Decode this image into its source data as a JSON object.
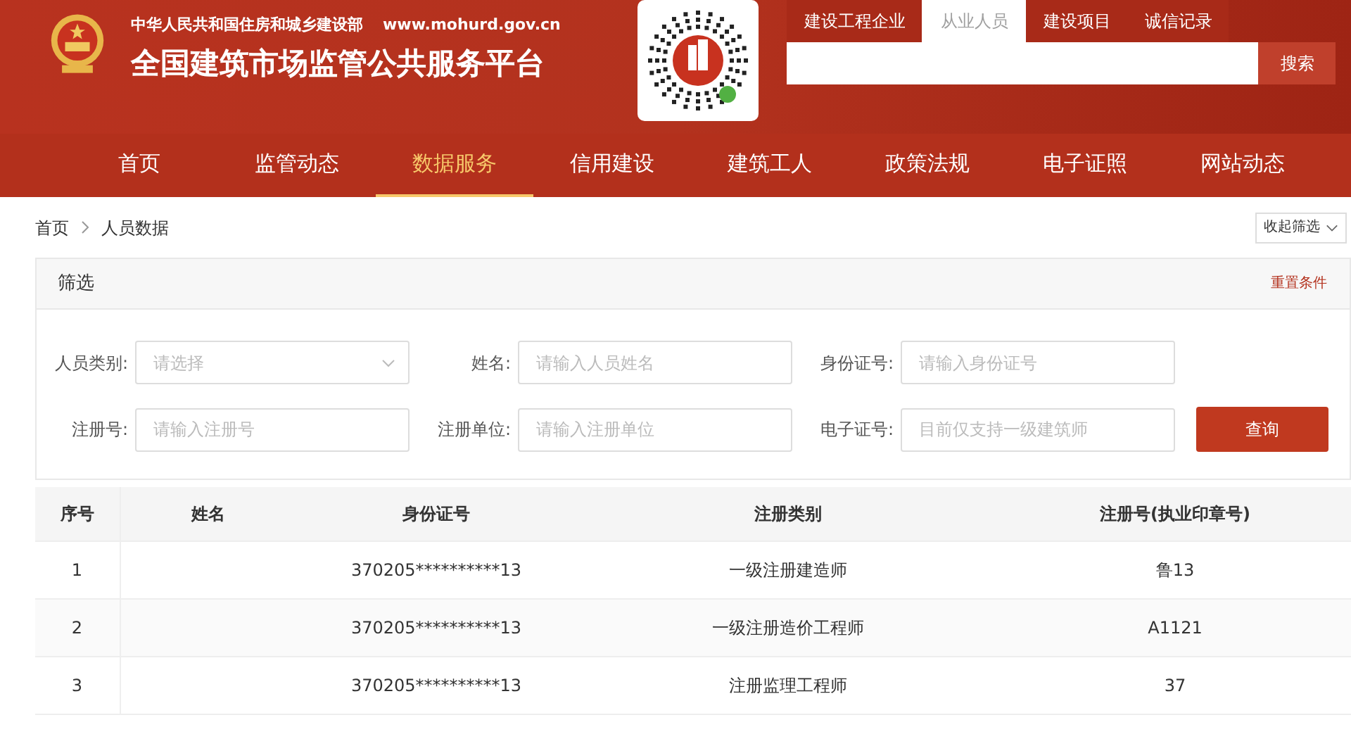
{
  "header": {
    "ministry": "中华人民共和国住房和城乡建设部",
    "url": "www.mohurd.gov.cn",
    "title": "全国建筑市场监管公共服务平台"
  },
  "search": {
    "tabs": [
      {
        "label": "建设工程企业",
        "selected": false
      },
      {
        "label": "从业人员",
        "selected": true
      },
      {
        "label": "建设项目",
        "selected": false
      },
      {
        "label": "诚信记录",
        "selected": false
      }
    ],
    "button": "搜索"
  },
  "nav": [
    {
      "label": "首页",
      "selected": false
    },
    {
      "label": "监管动态",
      "selected": false
    },
    {
      "label": "数据服务",
      "selected": true
    },
    {
      "label": "信用建设",
      "selected": false
    },
    {
      "label": "建筑工人",
      "selected": false
    },
    {
      "label": "政策法规",
      "selected": false
    },
    {
      "label": "电子证照",
      "selected": false
    },
    {
      "label": "网站动态",
      "selected": false
    }
  ],
  "breadcrumb": [
    "首页",
    "人员数据"
  ],
  "collapse_button": "收起筛选",
  "filter": {
    "title": "筛选",
    "reset": "重置条件",
    "fields": [
      {
        "label": "人员类别:",
        "placeholder": "请选择",
        "kind": "select"
      },
      {
        "label": "姓名:",
        "placeholder": "请输入人员姓名",
        "kind": "text"
      },
      {
        "label": "身份证号:",
        "placeholder": "请输入身份证号",
        "kind": "text"
      },
      {
        "label": "注册号:",
        "placeholder": "请输入注册号",
        "kind": "text"
      },
      {
        "label": "注册单位:",
        "placeholder": "请输入注册单位",
        "kind": "text"
      },
      {
        "label": "电子证号:",
        "placeholder": "目前仅支持一级建筑师",
        "kind": "text"
      }
    ],
    "submit": "查询"
  },
  "table": {
    "columns": [
      "序号",
      "姓名",
      "身份证号",
      "注册类别",
      "注册号(执业印章号)"
    ],
    "rows": [
      [
        "1",
        "",
        "370205**********13",
        "一级注册建造师",
        "鲁13"
      ],
      [
        "2",
        "",
        "370205**********13",
        "一级注册造价工程师",
        "A1121"
      ],
      [
        "3",
        "",
        "370205**********13",
        "注册监理工程师",
        "37"
      ]
    ]
  }
}
